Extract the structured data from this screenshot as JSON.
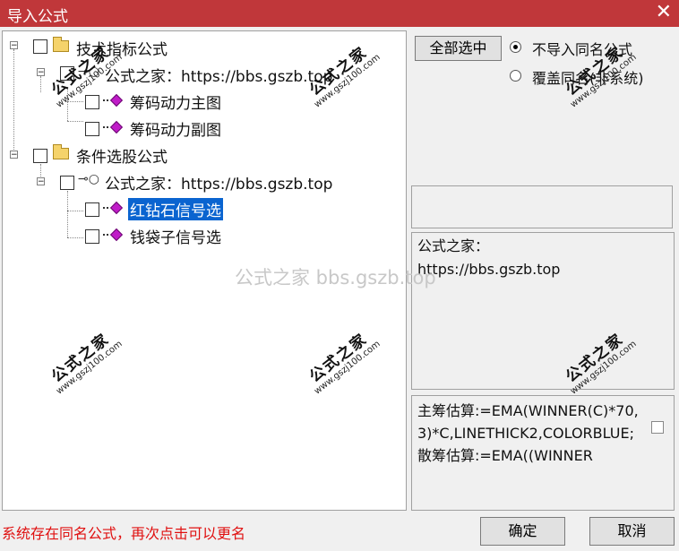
{
  "window": {
    "title": "导入公式",
    "close_glyph": "✕"
  },
  "tree": {
    "group1": {
      "label": "技术指标公式",
      "source": "公式之家：https://bbs.gszb.top",
      "items": [
        "筹码动力主图",
        "筹码动力副图"
      ]
    },
    "group2": {
      "label": "条件选股公式",
      "source": "公式之家：https://bbs.gszb.top",
      "items": [
        "红钻石信号选",
        "钱袋子信号选"
      ]
    }
  },
  "options": {
    "select_all": "全部选中",
    "radio_no_import": "不导入同名公式",
    "radio_overwrite": "覆盖同名(非系统)"
  },
  "description": {
    "line1": "公式之家：",
    "line2": "https://bbs.gszb.top"
  },
  "formula": "主筹估算:=EMA(WINNER(C)*70,3)*C,LINETHICK2,COLORBLUE;散筹估算:=EMA((WINNER",
  "status": "系统存在同名公式，再次点击可以更名",
  "buttons": {
    "ok": "确定",
    "cancel": "取消"
  },
  "watermark": {
    "center": "公式之家 bbs.gszb.top",
    "stamp_cn": "公式之家",
    "stamp_url": "www.gszj100.com"
  },
  "icons": [
    "folder-icon",
    "key-icon",
    "gem-icon",
    "radio-icon",
    "close-icon"
  ]
}
